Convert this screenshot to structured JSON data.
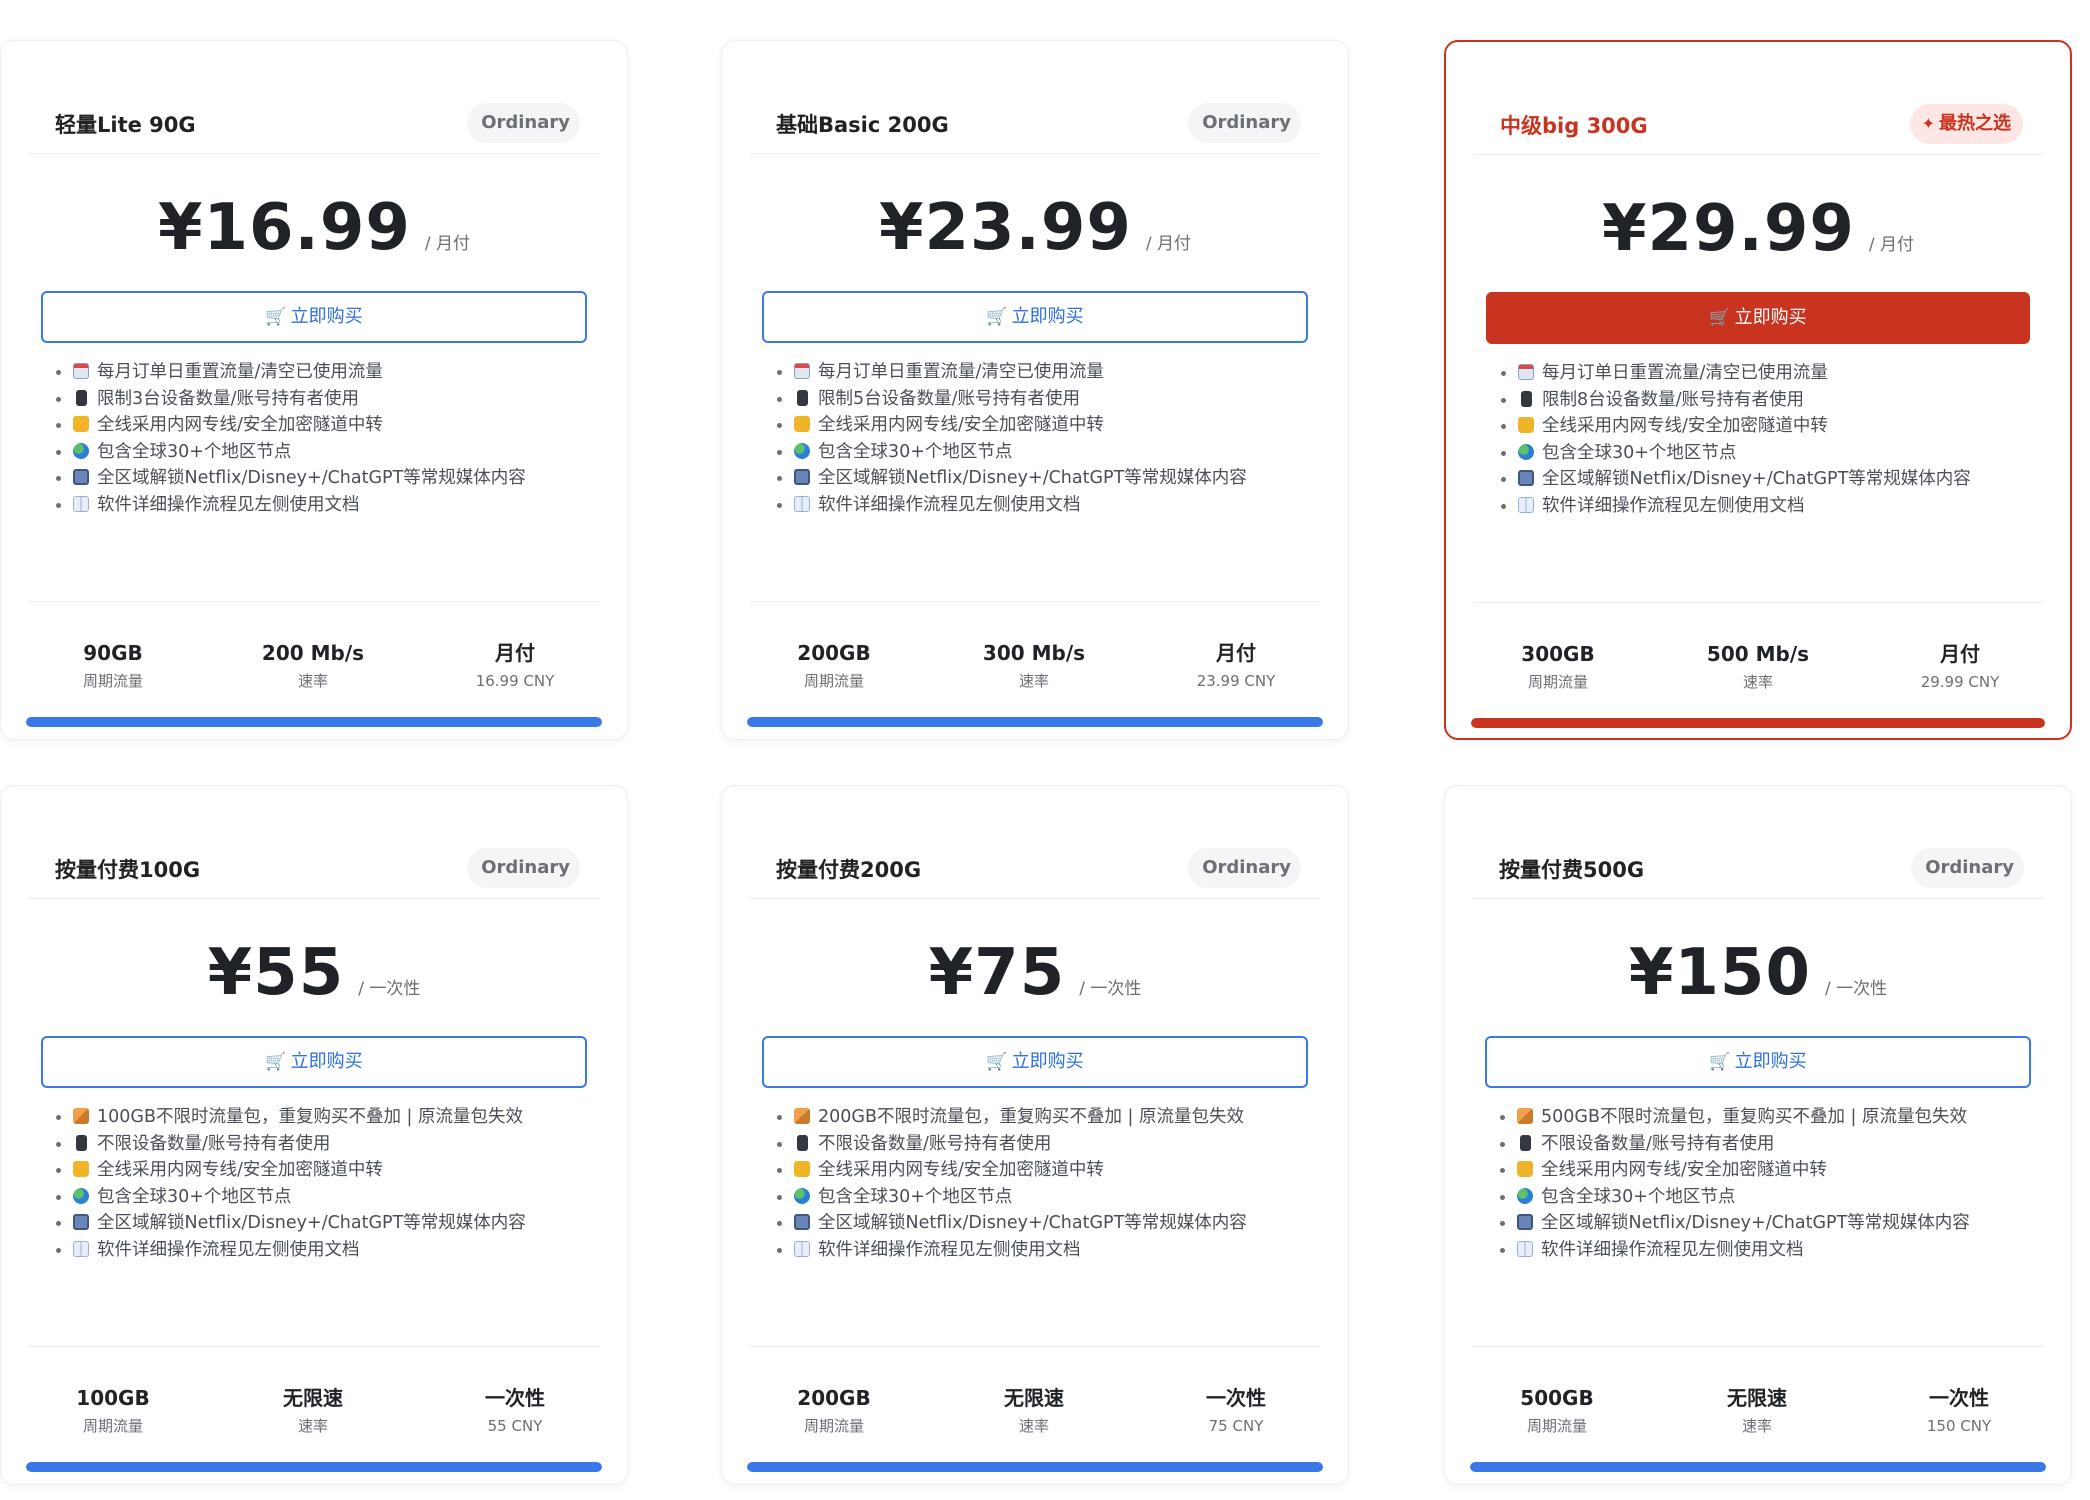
{
  "currency_symbol": "¥",
  "buy_label": "立即购买",
  "stat_labels": {
    "traffic": "周期流量",
    "speed": "速率"
  },
  "colors": {
    "accent_blue": "#3a78e8",
    "accent_red": "#c8341f"
  },
  "plans": [
    {
      "name": "轻量Lite 90G",
      "badge": "Ordinary",
      "featured": false,
      "price": "¥16.99",
      "period": "/ 月付",
      "features": [
        {
          "icon": "calendar-icon",
          "text": "每月订单日重置流量/清空已使用流量"
        },
        {
          "icon": "phone-icon",
          "text": "限制3台设备数量/账号持有者使用"
        },
        {
          "icon": "lock-icon",
          "text": "全线采用内网专线/安全加密隧道中转"
        },
        {
          "icon": "globe-icon",
          "text": "包含全球30+个地区节点"
        },
        {
          "icon": "tv-icon",
          "text": "全区域解锁Netflix/Disney+/ChatGPT等常规媒体内容"
        },
        {
          "icon": "book-icon",
          "text": "软件详细操作流程见左侧使用文档"
        }
      ],
      "stats": {
        "traffic": "90GB",
        "speed": "200 Mb/s",
        "billing": "月付",
        "amount": "16.99 CNY"
      },
      "progress": 1.0
    },
    {
      "name": "基础Basic 200G",
      "badge": "Ordinary",
      "featured": false,
      "price": "¥23.99",
      "period": "/ 月付",
      "features": [
        {
          "icon": "calendar-icon",
          "text": "每月订单日重置流量/清空已使用流量"
        },
        {
          "icon": "phone-icon",
          "text": "限制5台设备数量/账号持有者使用"
        },
        {
          "icon": "lock-icon",
          "text": "全线采用内网专线/安全加密隧道中转"
        },
        {
          "icon": "globe-icon",
          "text": "包含全球30+个地区节点"
        },
        {
          "icon": "tv-icon",
          "text": "全区域解锁Netflix/Disney+/ChatGPT等常规媒体内容"
        },
        {
          "icon": "book-icon",
          "text": "软件详细操作流程见左侧使用文档"
        }
      ],
      "stats": {
        "traffic": "200GB",
        "speed": "300 Mb/s",
        "billing": "月付",
        "amount": "23.99 CNY"
      },
      "progress": 1.0
    },
    {
      "name": "中级big 300G",
      "badge": "最热之选",
      "featured": true,
      "price": "¥29.99",
      "period": "/ 月付",
      "features": [
        {
          "icon": "calendar-icon",
          "text": "每月订单日重置流量/清空已使用流量"
        },
        {
          "icon": "phone-icon",
          "text": "限制8台设备数量/账号持有者使用"
        },
        {
          "icon": "lock-icon",
          "text": "全线采用内网专线/安全加密隧道中转"
        },
        {
          "icon": "globe-icon",
          "text": "包含全球30+个地区节点"
        },
        {
          "icon": "tv-icon",
          "text": "全区域解锁Netflix/Disney+/ChatGPT等常规媒体内容"
        },
        {
          "icon": "book-icon",
          "text": "软件详细操作流程见左侧使用文档"
        }
      ],
      "stats": {
        "traffic": "300GB",
        "speed": "500 Mb/s",
        "billing": "月付",
        "amount": "29.99 CNY"
      },
      "progress": 1.0
    },
    {
      "name": "按量付费100G",
      "badge": "Ordinary",
      "featured": false,
      "price": "¥55",
      "period": "/ 一次性",
      "features": [
        {
          "icon": "package-icon",
          "text": "100GB不限时流量包，重复购买不叠加 | 原流量包失效"
        },
        {
          "icon": "phone-icon",
          "text": "不限设备数量/账号持有者使用"
        },
        {
          "icon": "lock-icon",
          "text": "全线采用内网专线/安全加密隧道中转"
        },
        {
          "icon": "globe-icon",
          "text": "包含全球30+个地区节点"
        },
        {
          "icon": "tv-icon",
          "text": "全区域解锁Netflix/Disney+/ChatGPT等常规媒体内容"
        },
        {
          "icon": "book-icon",
          "text": "软件详细操作流程见左侧使用文档"
        }
      ],
      "stats": {
        "traffic": "100GB",
        "speed": "无限速",
        "billing": "一次性",
        "amount": "55 CNY"
      },
      "progress": 1.0
    },
    {
      "name": "按量付费200G",
      "badge": "Ordinary",
      "featured": false,
      "price": "¥75",
      "period": "/ 一次性",
      "features": [
        {
          "icon": "package-icon",
          "text": "200GB不限时流量包，重复购买不叠加 | 原流量包失效"
        },
        {
          "icon": "phone-icon",
          "text": "不限设备数量/账号持有者使用"
        },
        {
          "icon": "lock-icon",
          "text": "全线采用内网专线/安全加密隧道中转"
        },
        {
          "icon": "globe-icon",
          "text": "包含全球30+个地区节点"
        },
        {
          "icon": "tv-icon",
          "text": "全区域解锁Netflix/Disney+/ChatGPT等常规媒体内容"
        },
        {
          "icon": "book-icon",
          "text": "软件详细操作流程见左侧使用文档"
        }
      ],
      "stats": {
        "traffic": "200GB",
        "speed": "无限速",
        "billing": "一次性",
        "amount": "75 CNY"
      },
      "progress": 1.0
    },
    {
      "name": "按量付费500G",
      "badge": "Ordinary",
      "featured": false,
      "price": "¥150",
      "period": "/ 一次性",
      "features": [
        {
          "icon": "package-icon",
          "text": "500GB不限时流量包，重复购买不叠加 | 原流量包失效"
        },
        {
          "icon": "phone-icon",
          "text": "不限设备数量/账号持有者使用"
        },
        {
          "icon": "lock-icon",
          "text": "全线采用内网专线/安全加密隧道中转"
        },
        {
          "icon": "globe-icon",
          "text": "包含全球30+个地区节点"
        },
        {
          "icon": "tv-icon",
          "text": "全区域解锁Netflix/Disney+/ChatGPT等常规媒体内容"
        },
        {
          "icon": "book-icon",
          "text": "软件详细操作流程见左侧使用文档"
        }
      ],
      "stats": {
        "traffic": "500GB",
        "speed": "无限速",
        "billing": "一次性",
        "amount": "150 CNY"
      },
      "progress": 1.0
    }
  ]
}
